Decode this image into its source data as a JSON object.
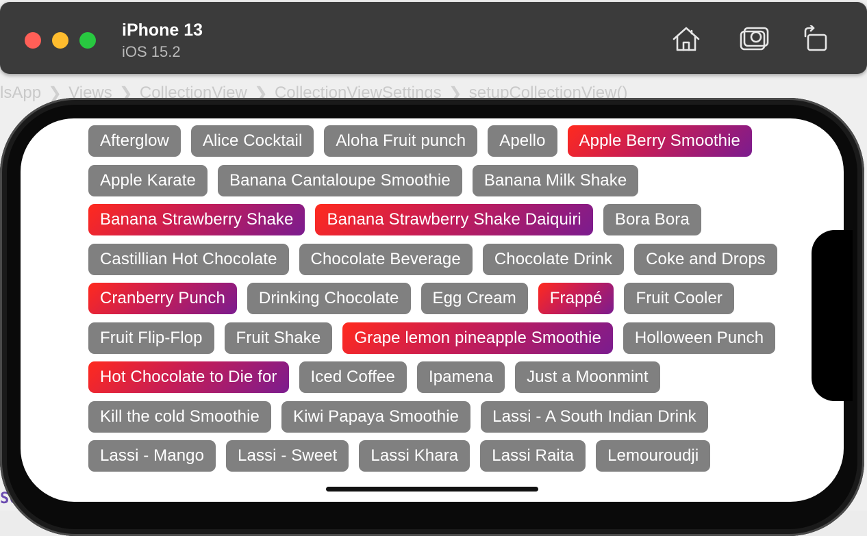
{
  "simulator": {
    "device_name": "iPhone 13",
    "os_version": "iOS 15.2",
    "home_icon": "home-icon",
    "screenshot_icon": "camera-icon",
    "rotate_icon": "rotate-icon"
  },
  "xcode": {
    "breadcrumb": [
      "lsApp",
      "Views",
      "CollectionView",
      "CollectionViewSettings",
      "setupCollectionView()"
    ],
    "bottom_fragment": "SCI"
  },
  "colors": {
    "tag_default": "#808080",
    "tag_selected_gradient": [
      "#ff2a1e",
      "#7b1c8f"
    ]
  },
  "tags": {
    "rows": [
      [
        {
          "label": "Afterglow",
          "selected": false
        },
        {
          "label": "Alice Cocktail",
          "selected": false
        },
        {
          "label": "Aloha Fruit punch",
          "selected": false
        },
        {
          "label": "Apello",
          "selected": false
        },
        {
          "label": "Apple Berry Smoothie",
          "selected": true
        }
      ],
      [
        {
          "label": "Apple Karate",
          "selected": false
        },
        {
          "label": "Banana Cantaloupe Smoothie",
          "selected": false
        },
        {
          "label": "Banana Milk Shake",
          "selected": false
        }
      ],
      [
        {
          "label": "Banana Strawberry Shake",
          "selected": true
        },
        {
          "label": "Banana Strawberry Shake Daiquiri",
          "selected": true
        },
        {
          "label": "Bora Bora",
          "selected": false
        }
      ],
      [
        {
          "label": "Castillian Hot Chocolate",
          "selected": false
        },
        {
          "label": "Chocolate Beverage",
          "selected": false
        },
        {
          "label": "Chocolate Drink",
          "selected": false
        },
        {
          "label": "Coke and Drops",
          "selected": false
        }
      ],
      [
        {
          "label": "Cranberry Punch",
          "selected": true
        },
        {
          "label": "Drinking Chocolate",
          "selected": false
        },
        {
          "label": "Egg Cream",
          "selected": false
        },
        {
          "label": "Frappé",
          "selected": true
        },
        {
          "label": "Fruit Cooler",
          "selected": false
        }
      ],
      [
        {
          "label": "Fruit Flip-Flop",
          "selected": false
        },
        {
          "label": "Fruit Shake",
          "selected": false
        },
        {
          "label": "Grape lemon pineapple Smoothie",
          "selected": true
        },
        {
          "label": "Holloween Punch",
          "selected": false
        }
      ],
      [
        {
          "label": "Hot Chocolate to Die for",
          "selected": true
        },
        {
          "label": "Iced Coffee",
          "selected": false
        },
        {
          "label": "Ipamena",
          "selected": false
        },
        {
          "label": "Just a Moonmint",
          "selected": false
        }
      ],
      [
        {
          "label": "Kill the cold Smoothie",
          "selected": false
        },
        {
          "label": "Kiwi Papaya Smoothie",
          "selected": false
        },
        {
          "label": "Lassi - A South Indian Drink",
          "selected": false
        }
      ],
      [
        {
          "label": "Lassi - Mango",
          "selected": false
        },
        {
          "label": "Lassi - Sweet",
          "selected": false
        },
        {
          "label": "Lassi Khara",
          "selected": false
        },
        {
          "label": "Lassi Raita",
          "selected": false
        },
        {
          "label": "Lemouroudji",
          "selected": false
        }
      ]
    ]
  }
}
